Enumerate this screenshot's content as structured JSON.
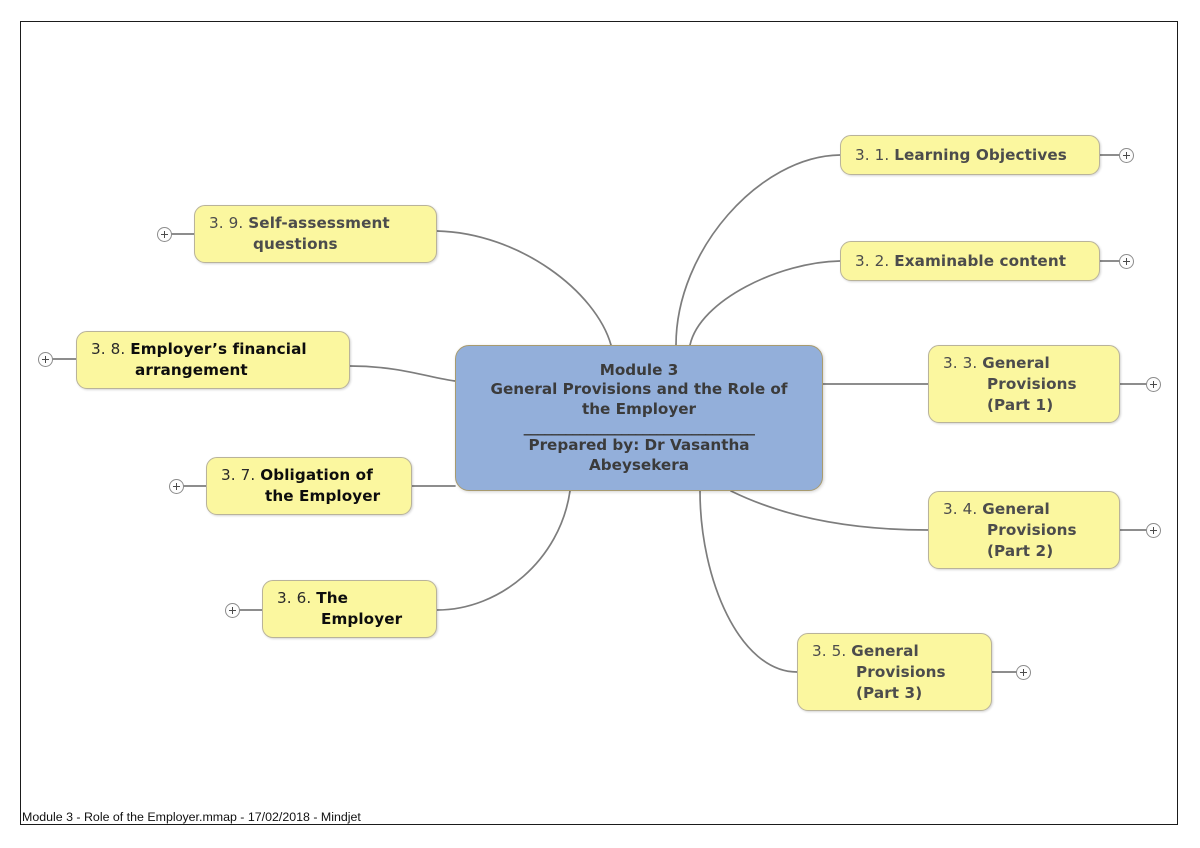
{
  "document": {
    "footer": "Module 3 - Role of the Employer.mmap - 17/02/2018 - Mindjet"
  },
  "colors": {
    "topic_fill": "#FBF79F",
    "topic_border": "#B9B39A",
    "central_fill": "#93AFDA",
    "central_border": "#A89B6F",
    "connector": "#7D7D7D",
    "topic_text": "#4C4C4C",
    "topic_text_dark": "#0D0D0D",
    "central_text": "#3B3B3B",
    "page_border": "#1B1B1B"
  },
  "central": {
    "line1": "Module 3",
    "line2": "General Provisions and the Role of",
    "line3": "the  Employer",
    "rule": "_________________________________",
    "line4": "Prepared by: Dr Vasantha",
    "line5": "Abeysekera"
  },
  "chart_data": {
    "type": "diagram",
    "diagram_kind": "mind-map",
    "root": "Module 3 General Provisions and the Role of the  Employer",
    "branch_count": 9,
    "branches": [
      {
        "number": "3. 1.",
        "title": "Learning Objectives",
        "side": "right",
        "expandable": true
      },
      {
        "number": "3. 2.",
        "title": "Examinable content",
        "side": "right",
        "expandable": true
      },
      {
        "number": "3. 3.",
        "title": "General Provisions (Part 1)",
        "side": "right",
        "expandable": true
      },
      {
        "number": "3. 4.",
        "title": "General Provisions (Part 2)",
        "side": "right",
        "expandable": true
      },
      {
        "number": "3. 5.",
        "title": "General Provisions (Part 3)",
        "side": "right",
        "expandable": true
      },
      {
        "number": "3. 6.",
        "title": "The Employer",
        "side": "left",
        "expandable": true
      },
      {
        "number": "3. 7.",
        "title": "Obligation of the Employer",
        "side": "left",
        "expandable": true
      },
      {
        "number": "3. 8.",
        "title": "Employer’s financial arrangement",
        "side": "left",
        "expandable": true
      },
      {
        "number": "3. 9.",
        "title": "Self-assessment questions",
        "side": "left",
        "expandable": true
      }
    ]
  },
  "nodes": {
    "n1": {
      "num": "3. 1.",
      "title": "Learning Objectives"
    },
    "n2": {
      "num": "3. 2.",
      "title": "Examinable content"
    },
    "n3": {
      "num": "3. 3.",
      "title": "General Provisions (Part 1)"
    },
    "n4": {
      "num": "3. 4.",
      "title": "General Provisions (Part 2)"
    },
    "n5": {
      "num": "3. 5.",
      "title": "General Provisions (Part 3)"
    },
    "n6": {
      "num": "3. 6.",
      "title": "The Employer"
    },
    "n7": {
      "num": "3. 7.",
      "title": "Obligation of the Employer"
    },
    "n8": {
      "num": "3. 8.",
      "title": "Employer’s financial arrangement"
    },
    "n9": {
      "num": "3. 9.",
      "title": "Self-assessment questions"
    }
  }
}
